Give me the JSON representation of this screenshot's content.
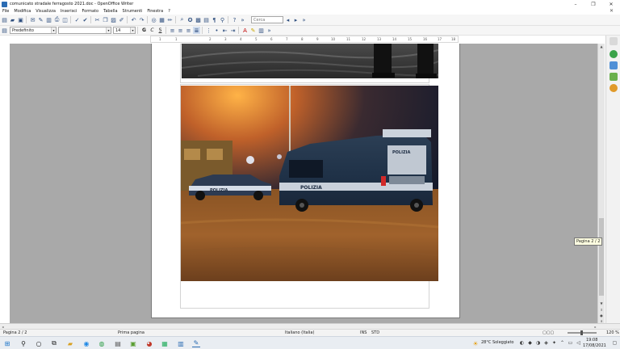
{
  "window": {
    "title": "comunicato stradale ferragosto 2021.doc - OpenOffice Writer",
    "buttons": {
      "minimize": "–",
      "maximize": "❐",
      "close": "✕"
    }
  },
  "menu": {
    "items": [
      "File",
      "Modifica",
      "Visualizza",
      "Inserisci",
      "Formato",
      "Tabella",
      "Strumenti",
      "Finestra",
      "?"
    ]
  },
  "toolbar": {
    "find_placeholder": "Cerca",
    "paragraph_style": "Predefinito",
    "font_name": "",
    "font_size": "14",
    "bold": "G",
    "italic": "C",
    "underline": "S"
  },
  "ruler": {
    "ticks": [
      "1",
      "1",
      "2",
      "3",
      "4",
      "5",
      "6",
      "7",
      "8",
      "9",
      "10",
      "11",
      "12",
      "13",
      "14",
      "15",
      "16",
      "17",
      "18"
    ]
  },
  "tooltip": {
    "text": "Pagina 2 / 2"
  },
  "status": {
    "page": "Pagina 2 / 2",
    "page_style": "Prima pagina",
    "language": "Italiano (Italia)",
    "insert_mode": "INS",
    "selection_mode": "STD",
    "zoom": "120 %"
  },
  "taskbar": {
    "weather": "28°C  Soleggiato",
    "time": "19:08",
    "date": "17/08/2021"
  },
  "colors": {
    "workspace": "#a9a9a9",
    "accent": "#2b6cb3",
    "tooltip_bg": "#ffffe1"
  }
}
